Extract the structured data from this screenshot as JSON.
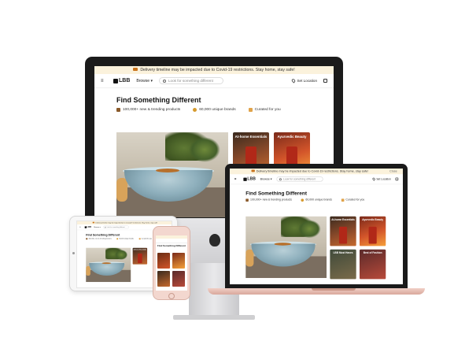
{
  "site": {
    "banner": "Delivery timeline may be impacted due to Covid-19 restrictions. Stay home, stay safe!",
    "banner_close": "Close",
    "logo": "LBB",
    "browse": "Browse",
    "search_placeholder": "Look for something different",
    "location": "Set Location",
    "hero_title": "Find Something Different",
    "stats": [
      {
        "icon": "box-icon",
        "label": "100,000+ new & trending products"
      },
      {
        "icon": "coin-icon",
        "label": "60,000 unique brands"
      },
      {
        "icon": "bag-icon",
        "label": "Curated for you"
      }
    ],
    "cards": [
      {
        "title": "At-home Essentials"
      },
      {
        "title": "Ayurvedic Beauty"
      },
      {
        "title": "LBB Must Haves"
      },
      {
        "title": "Best of Fashion"
      }
    ]
  },
  "colors": {
    "banner_bg": "#fbf2dc",
    "imac_bezel": "#1b1b1b",
    "macbook_base": "#e8bcb0",
    "iphone_body": "#f3d7cf"
  }
}
